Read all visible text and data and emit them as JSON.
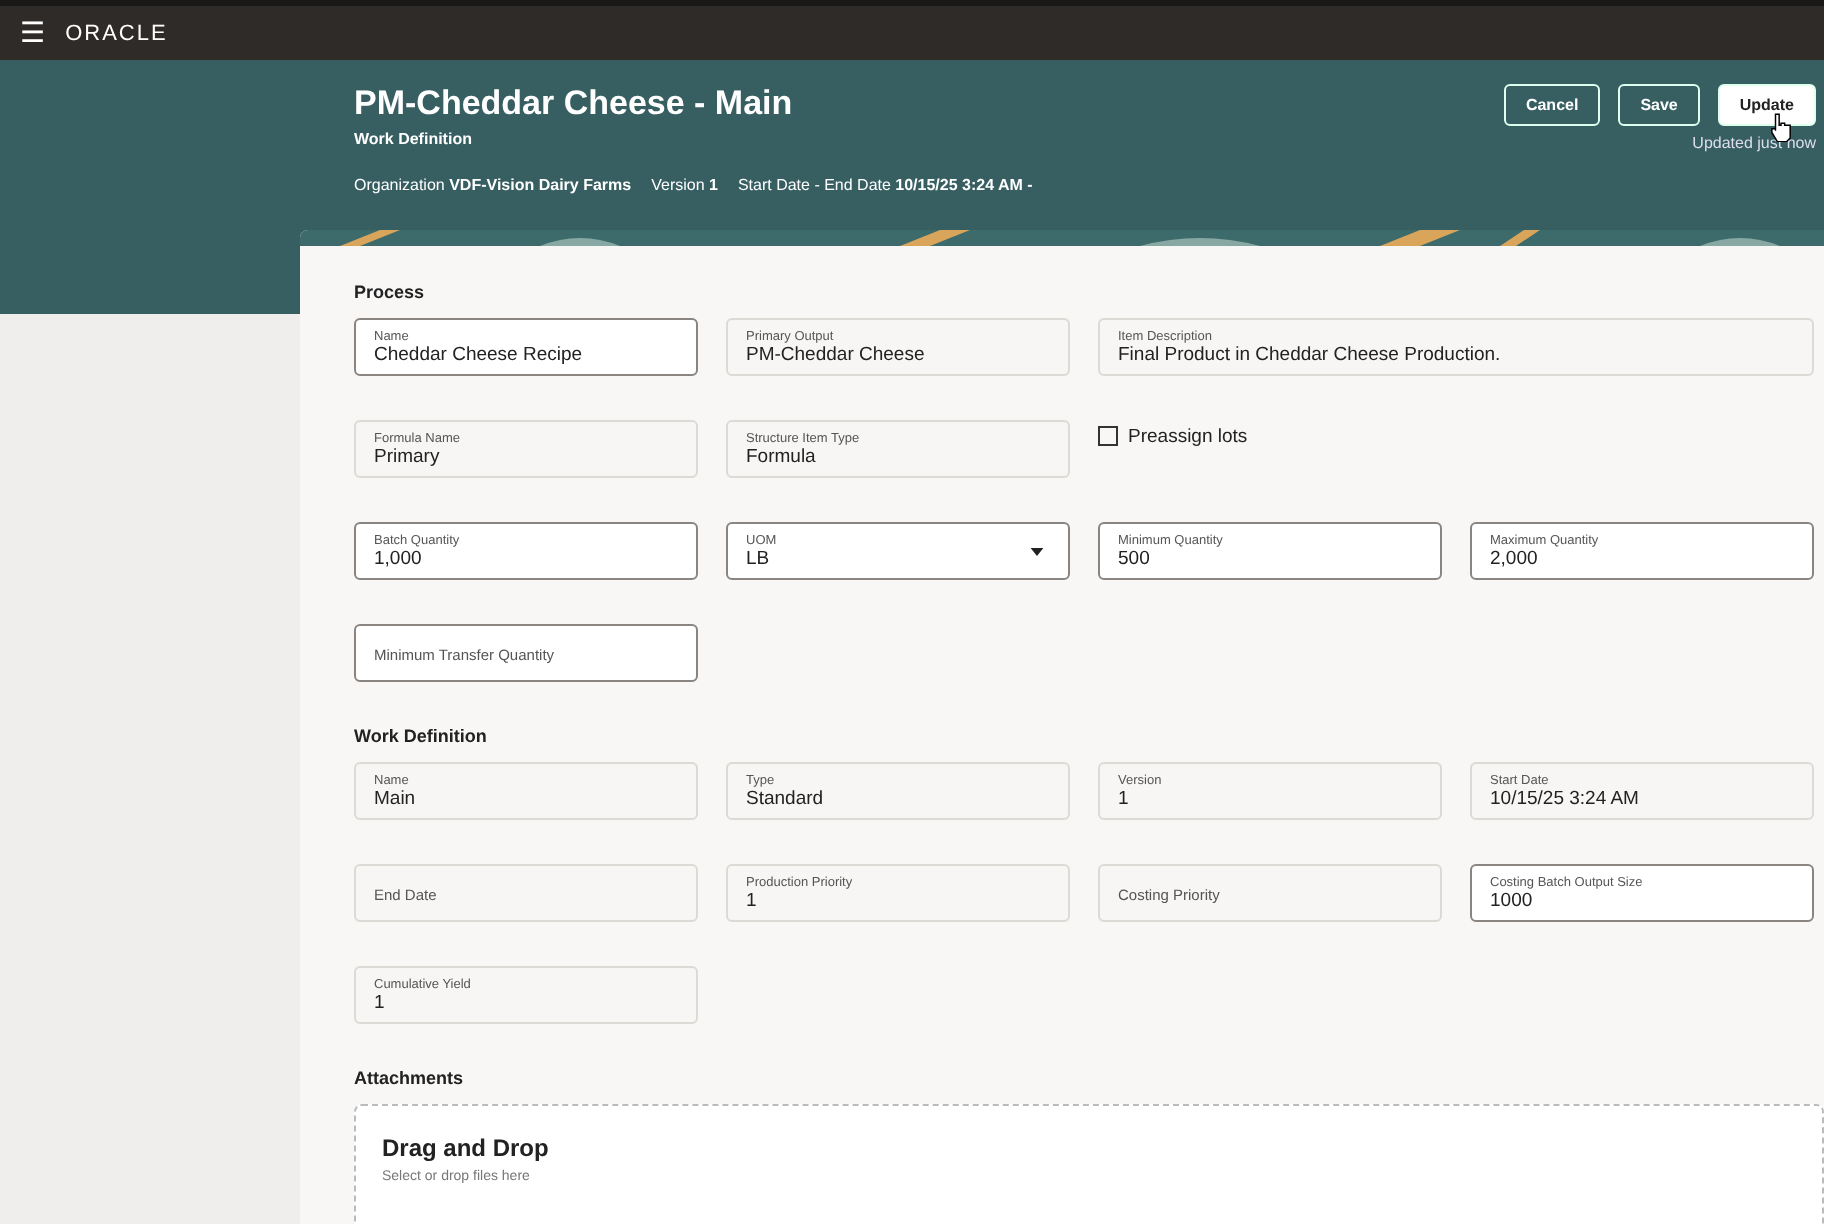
{
  "topbar": {
    "menu_icon": "☰",
    "logo": "ORACLE"
  },
  "header": {
    "title": "PM-Cheddar Cheese - Main",
    "subtitle": "Work Definition",
    "meta": [
      {
        "label": "Organization",
        "value": "VDF-Vision Dairy Farms"
      },
      {
        "label": "Version",
        "value": "1"
      },
      {
        "label": "Start Date - End Date",
        "value": "10/15/25 3:24 AM -"
      }
    ],
    "buttons": [
      {
        "label": "Cancel",
        "primary": false
      },
      {
        "label": "Save",
        "primary": false
      },
      {
        "label": "Update",
        "primary": true
      }
    ],
    "status": "Updated just now"
  },
  "sections": [
    {
      "title": "Process",
      "rows": [
        [
          {
            "kind": "input",
            "label": "Name",
            "value": "Cheddar Cheese Recipe"
          },
          {
            "kind": "readonly",
            "label": "Primary Output",
            "value": "PM-Cheddar Cheese"
          },
          {
            "kind": "description",
            "label": "Item Description",
            "value": "Final Product in Cheddar Cheese Production."
          }
        ],
        [
          {
            "kind": "readonly",
            "label": "Formula Name",
            "value": "Primary"
          },
          {
            "kind": "readonly",
            "label": "Structure Item Type",
            "value": "Formula"
          },
          {
            "kind": "checkbox",
            "label": "Preassign lots",
            "checked": false
          }
        ],
        [
          {
            "kind": "input",
            "label": "Batch Quantity",
            "value": "1,000"
          },
          {
            "kind": "select",
            "label": "UOM",
            "value": "LB"
          },
          {
            "kind": "input",
            "label": "Minimum Quantity",
            "value": "500"
          },
          {
            "kind": "input",
            "label": "Maximum Quantity",
            "value": "2,000"
          }
        ],
        [
          {
            "kind": "input",
            "label": "Minimum Transfer Quantity"
          }
        ]
      ]
    },
    {
      "title": "Work Definition",
      "rows": [
        [
          {
            "kind": "readonly",
            "label": "Name",
            "value": "Main"
          },
          {
            "kind": "readonly",
            "label": "Type",
            "value": "Standard"
          },
          {
            "kind": "readonly",
            "label": "Version",
            "value": "1"
          },
          {
            "kind": "readonly",
            "label": "Start Date",
            "value": "10/15/25 3:24 AM"
          }
        ],
        [
          {
            "kind": "readonly",
            "label": "End Date"
          },
          {
            "kind": "readonly",
            "label": "Production Priority",
            "value": "1"
          },
          {
            "kind": "readonly",
            "label": "Costing Priority"
          },
          {
            "kind": "input",
            "label": "Costing Batch Output Size",
            "value": "1000"
          }
        ],
        [
          {
            "kind": "readonly",
            "label": "Cumulative Yield",
            "value": "1"
          }
        ]
      ]
    }
  ],
  "attachments": {
    "title": "Attachments",
    "drop_title": "Drag and Drop",
    "drop_hint": "Select or drop files here"
  }
}
